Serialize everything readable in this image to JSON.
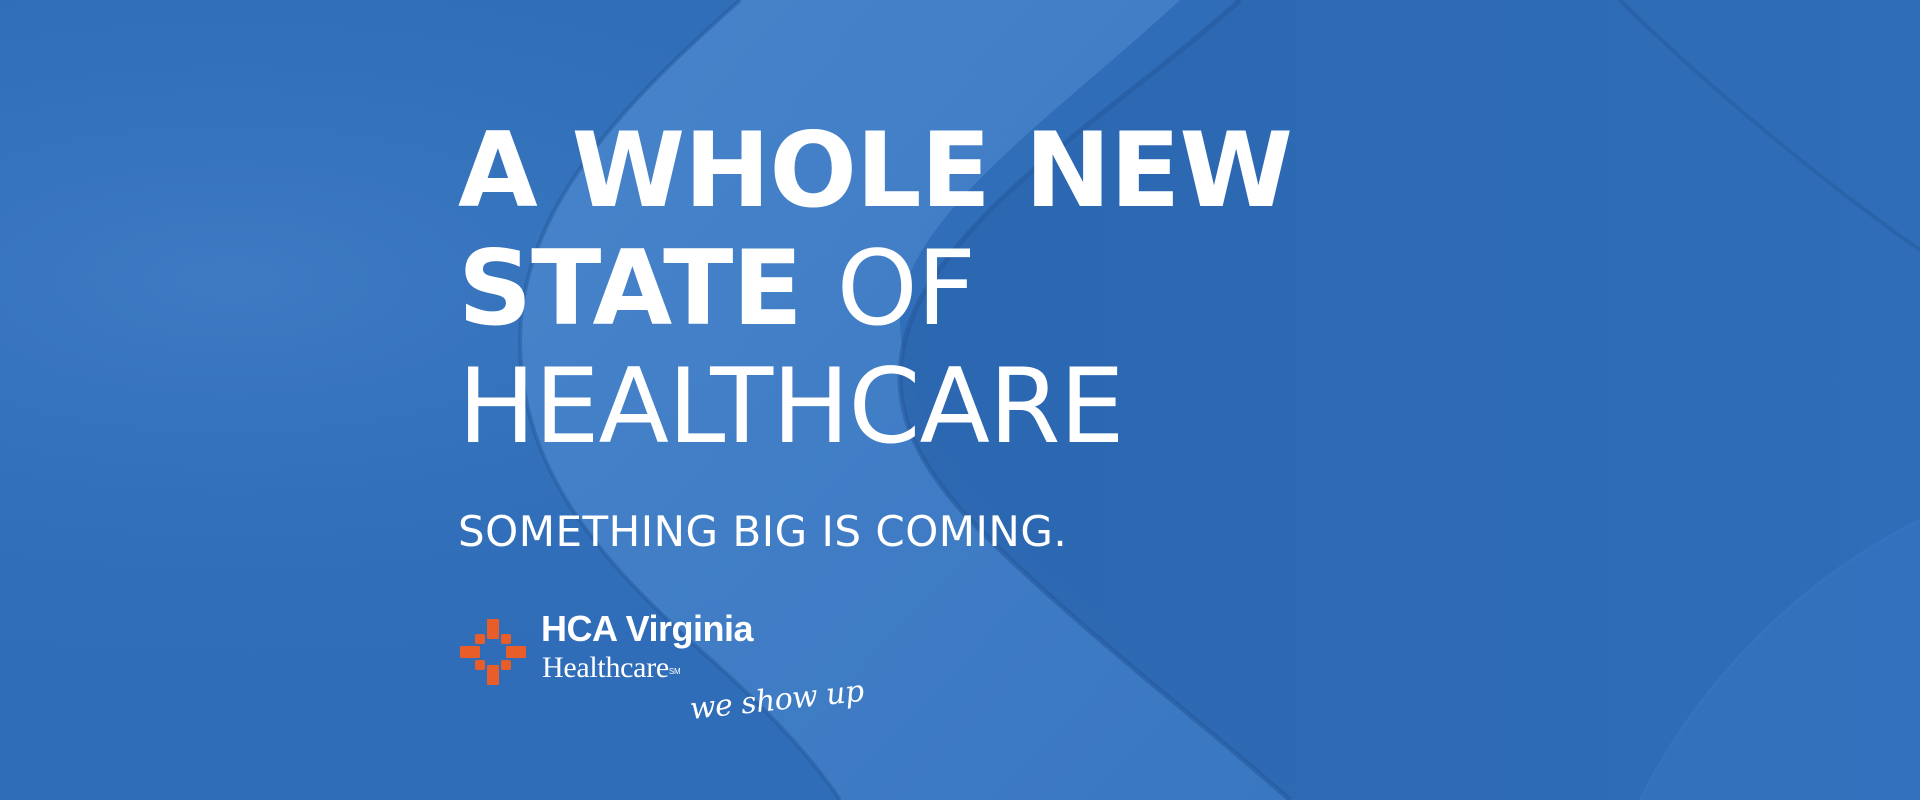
{
  "banner": {
    "background_color": "#2f6db8",
    "headline": {
      "line1": "A WHOLE NEW",
      "line2_bold": "STATE",
      "line2_light": "OF",
      "line3": "HEALTHCARE"
    },
    "tagline": "SOMETHING BIG IS COMING.",
    "logo": {
      "name": "HCA Virginia",
      "sub": "Healthcare",
      "sub_mark": "SM",
      "slogan": "we show up",
      "accent_color": "#e85d2a"
    }
  }
}
